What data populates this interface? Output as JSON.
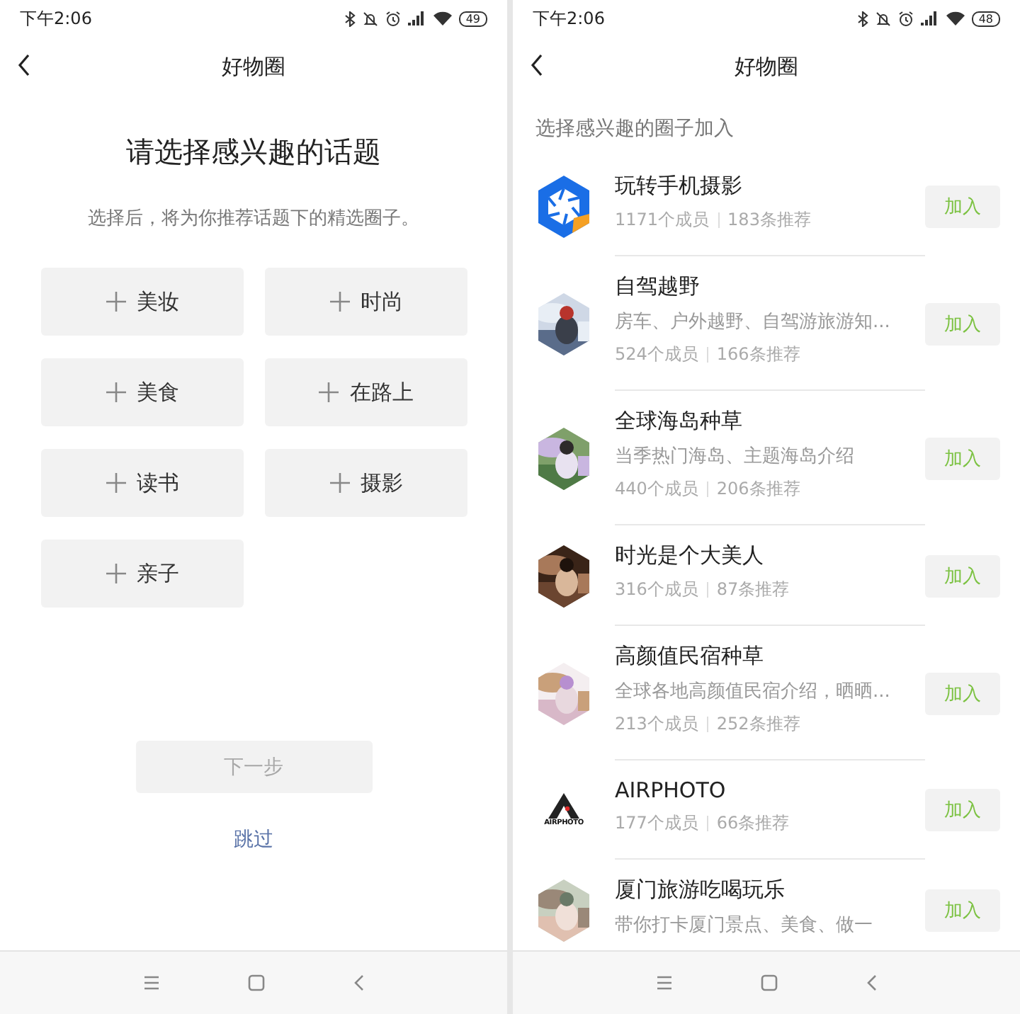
{
  "left": {
    "status_bar": {
      "time": "下午2:06",
      "battery": "49"
    },
    "header": {
      "title": "好物圈"
    },
    "heading": "请选择感兴趣的话题",
    "subtitle": "选择后，将为你推荐话题下的精选圈子。",
    "topics": [
      {
        "label": "美妆",
        "selected": false
      },
      {
        "label": "时尚",
        "selected": false
      },
      {
        "label": "美食",
        "selected": false
      },
      {
        "label": "在路上",
        "selected": false
      },
      {
        "label": "读书",
        "selected": false
      },
      {
        "label": "摄影",
        "selected": false
      },
      {
        "label": "亲子",
        "selected": false
      }
    ],
    "next_button": {
      "label": "下一步",
      "disabled": true
    },
    "skip_link": "跳过"
  },
  "right": {
    "status_bar": {
      "time": "下午2:06",
      "battery": "48"
    },
    "header": {
      "title": "好物圈"
    },
    "section_title": "选择感兴趣的圈子加入",
    "circles": [
      {
        "avatar": {
          "kind": "aperture"
        },
        "name": "玩转手机摄影",
        "members": "1171个成员",
        "posts": "183条推荐",
        "join": "加入"
      },
      {
        "name": "自驾越野",
        "description": "房车、户外越野、自驾游旅游知...",
        "members": "524个成员",
        "posts": "166条推荐",
        "join": "加入"
      },
      {
        "name": "全球海岛种草",
        "description": "当季热门海岛、主题海岛介绍",
        "members": "440个成员",
        "posts": "206条推荐",
        "join": "加入"
      },
      {
        "name": "时光是个大美人",
        "members": "316个成员",
        "posts": "87条推荐",
        "join": "加入"
      },
      {
        "name": "高颜值民宿种草",
        "description": "全球各地高颜值民宿介绍，晒晒...",
        "members": "213个成员",
        "posts": "252条推荐",
        "join": "加入"
      },
      {
        "avatar": {
          "kind": "airphoto",
          "logo_text": "AIRPHOTO"
        },
        "name": "AIRPHOTO",
        "members": "177个成员",
        "posts": "66条推荐",
        "join": "加入"
      },
      {
        "name": "厦门旅游吃喝玩乐",
        "description": "带你打卡厦门景点、美食、做一",
        "join": "加入"
      }
    ]
  }
}
